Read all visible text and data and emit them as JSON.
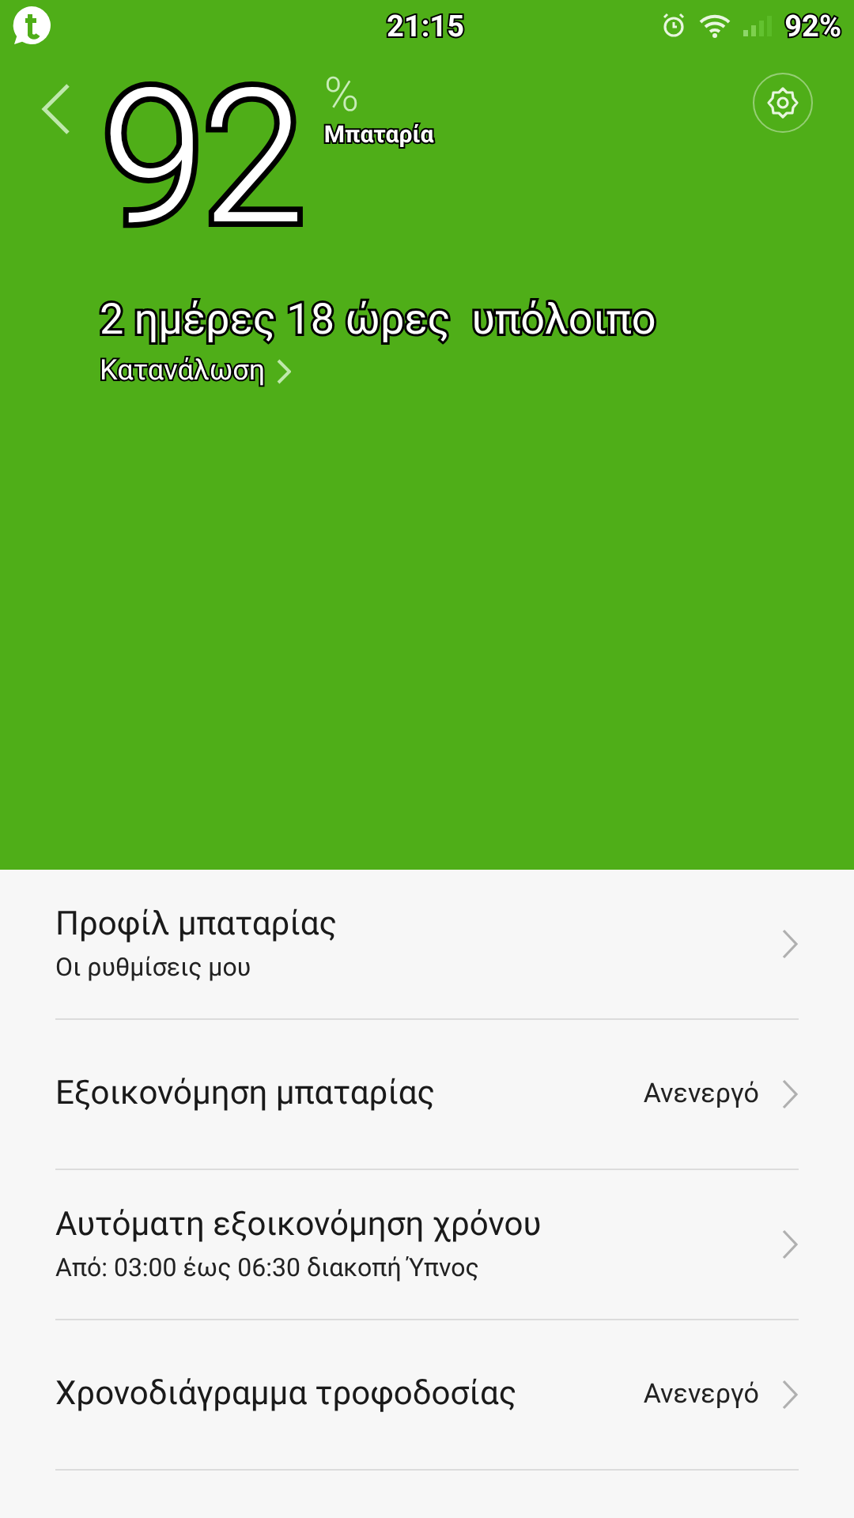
{
  "status_bar": {
    "time": "21:15",
    "battery": "92%"
  },
  "header": {
    "percent": "92",
    "percent_sign": "%",
    "label": "Μπαταρία",
    "remaining": "2 ημέρες 18 ώρες  υπόλοιπο",
    "consumption_link": "Κατανάλωση"
  },
  "settings": [
    {
      "title": "Προφίλ μπαταρίας",
      "subtitle": "Οι ρυθμίσεις μου"
    },
    {
      "title": "Εξοικονόμηση μπαταρίας",
      "value": "Ανενεργό"
    },
    {
      "title": "Αυτόματη εξοικονόμηση χρόνου",
      "subtitle": "Από: 03:00 έως 06:30 διακοπή Ύπνος"
    },
    {
      "title": "Χρονοδιάγραμμα τροφοδοσίας",
      "value": "Ανενεργό"
    }
  ]
}
